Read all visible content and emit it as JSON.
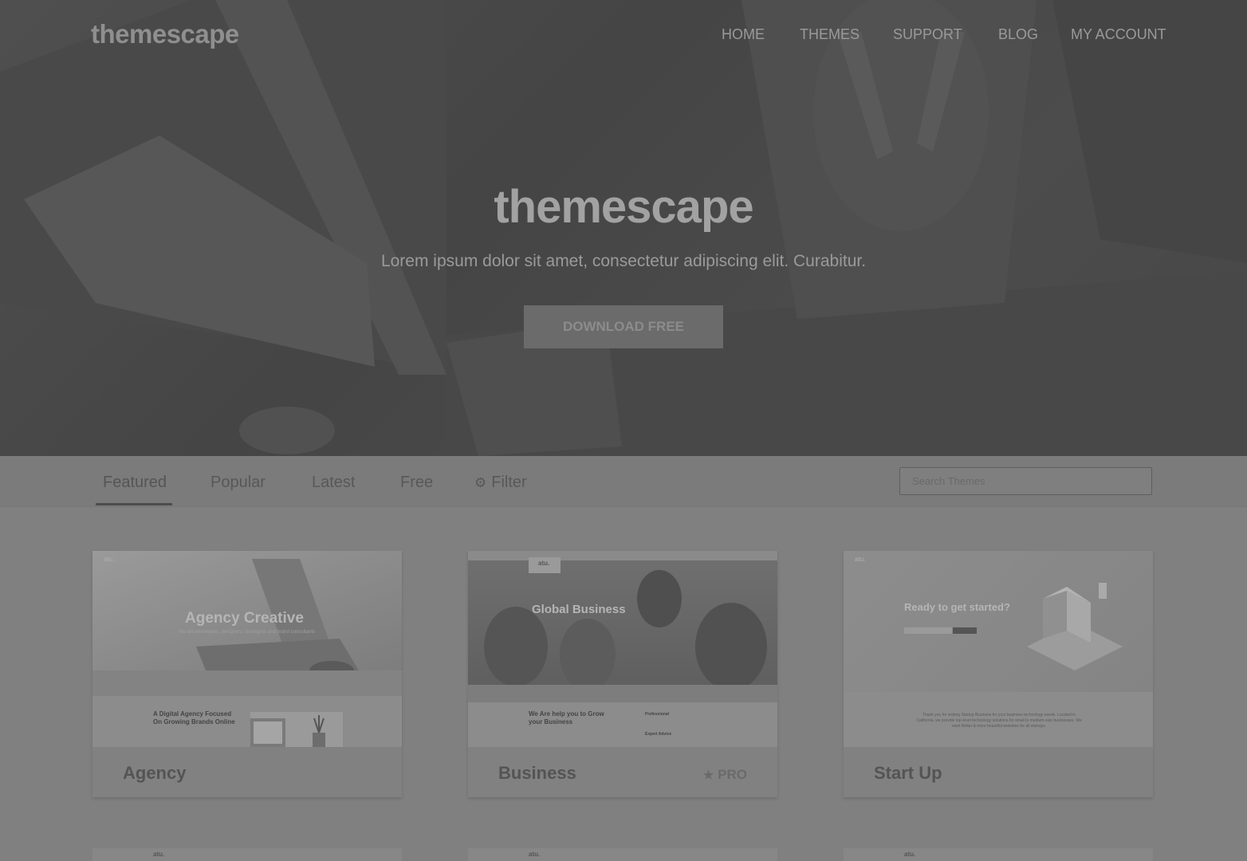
{
  "header": {
    "logo": "themescape",
    "nav": [
      "HOME",
      "THEMES",
      "SUPPORT",
      "BLOG",
      "MY ACCOUNT"
    ]
  },
  "hero": {
    "title": "themescape",
    "subtitle": "Lorem ipsum dolor sit amet, consectetur adipiscing elit. Curabitur.",
    "cta": "DOWNLOAD FREE"
  },
  "tabs": {
    "items": [
      "Featured",
      "Popular",
      "Latest",
      "Free"
    ],
    "filter": "Filter",
    "active": "Featured"
  },
  "search": {
    "placeholder": "Search Themes"
  },
  "cards": [
    {
      "title": "Agency",
      "badge": "",
      "thumb": {
        "brand": "atu.",
        "headline": "Agency Creative",
        "tagline": "We are developers, designers, strategists and brand consultants",
        "section_heading": "A Digital Agency Focused On Growing Brands Online"
      }
    },
    {
      "title": "Business",
      "badge": "PRO",
      "thumb": {
        "brand": "atu.",
        "headline": "Global Business",
        "section_heading": "We Are help you to Grow your Business",
        "feature_1": "Professional",
        "feature_2": "Expert Advice"
      }
    },
    {
      "title": "Start Up",
      "badge": "",
      "thumb": {
        "brand": "atu.",
        "headline": "Ready to get started?",
        "body": "Thank you for visiting Startup Business for your business technology needs. Located in California, we provide top-level technology solutions for small to medium-size businesses. We want Better & more beautiful websites for all startups."
      }
    }
  ],
  "row2_brands": [
    "atu.",
    "atu.",
    "atu."
  ],
  "colors": {
    "overlay": "#808080",
    "hero_text": "#a2a2a2",
    "tab_underline": "#4d4d4d"
  },
  "icons": {
    "filter": "gear-icon",
    "pro": "star-icon"
  }
}
